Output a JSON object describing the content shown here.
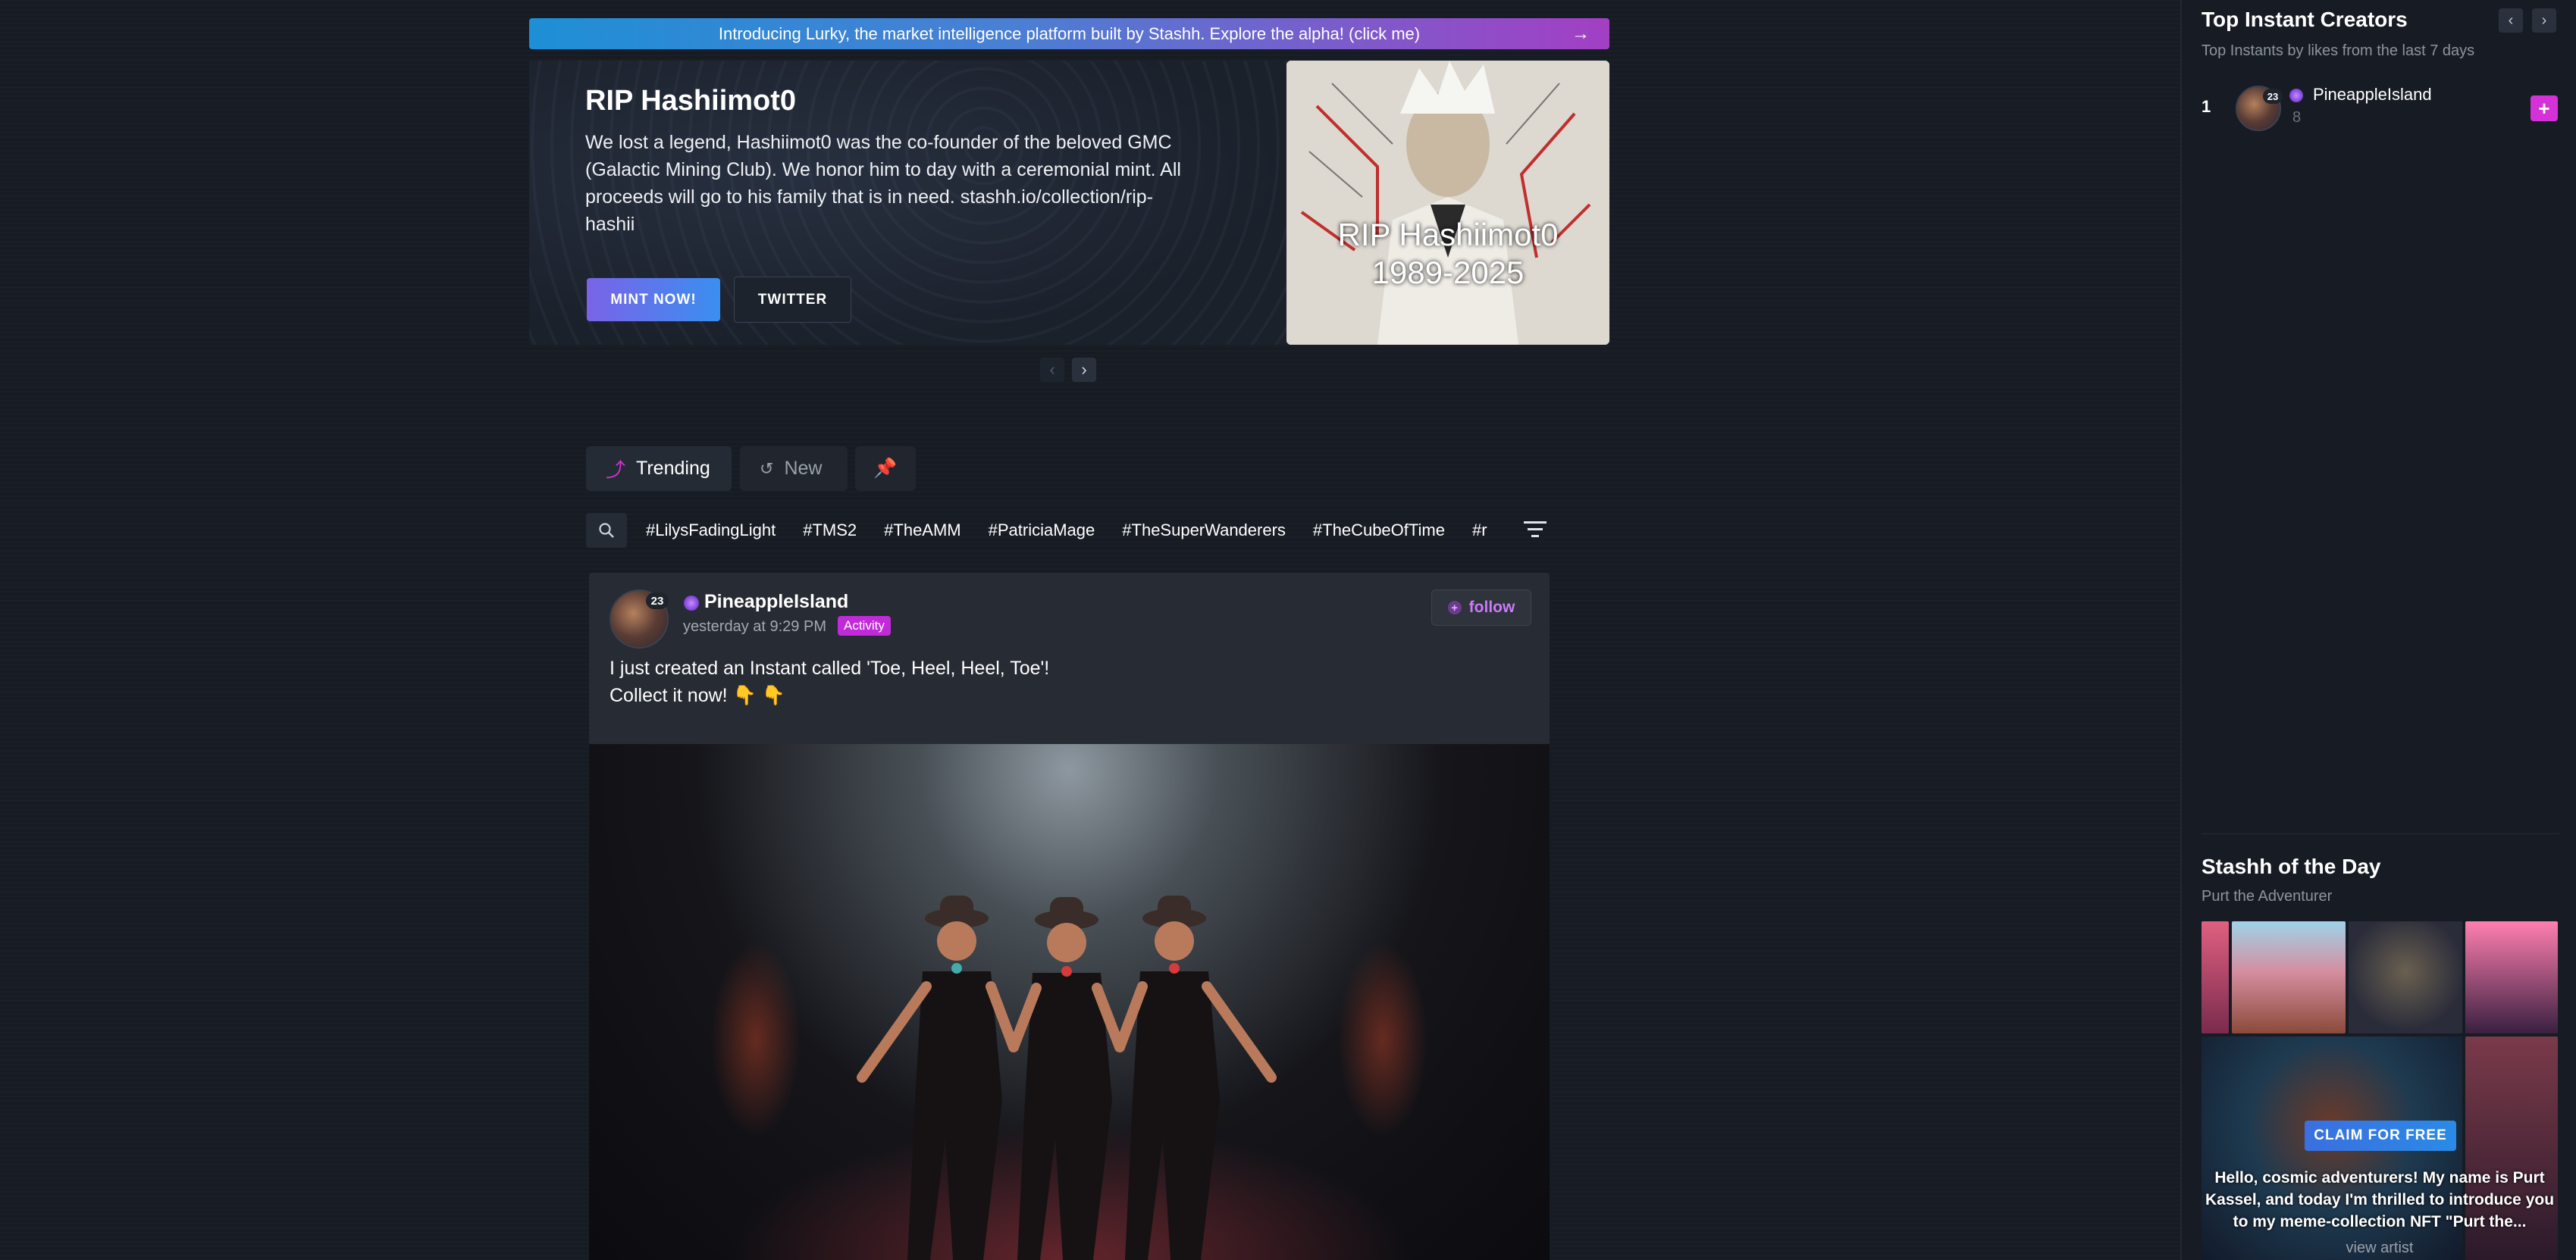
{
  "banner": {
    "text": "Introducing Lurky, the market intelligence platform built by Stashh. Explore the alpha! (click me)",
    "arrow": "→"
  },
  "hero": {
    "title": "RIP Hashiimot0",
    "description": "We lost a legend, Hashiimot0 was the co-founder of the beloved GMC (Galactic Mining Club). We honor him to day with a ceremonial mint. All proceeds will go to his family that is in need. stashh.io/collection/rip-hashii",
    "mint_label": "MINT NOW!",
    "twitter_label": "TWITTER",
    "image_caption_line1": "RIP Hashiimot0",
    "image_caption_line2": "1989-2025"
  },
  "tabs": [
    {
      "label": "Trending",
      "icon": "trending-arrow-icon"
    },
    {
      "label": "New",
      "icon": "history-icon"
    },
    {
      "label": "",
      "icon": "pin-icon"
    }
  ],
  "hashtags": [
    "#LilysFadingLight",
    "#TMS2",
    "#TheAMM",
    "#PatriciaMage",
    "#TheSuperWanderers",
    "#TheCubeOfTime",
    "#r"
  ],
  "post": {
    "level": "23",
    "user": "PineappleIsland",
    "time": "yesterday at 9:29 PM",
    "tag": "Activity",
    "follow_label": "follow",
    "text_line1": "I just created an Instant called 'Toe, Heel, Heel, Toe'!",
    "text_line2": "Collect it now! 👇 👇"
  },
  "sidebar": {
    "title": "Top Instant Creators",
    "subtitle": "Top Instants by likes from the last 7 days",
    "creators": [
      {
        "rank": "1",
        "level": "23",
        "user": "PineappleIsland",
        "likes": "8"
      }
    ],
    "add_label": "+",
    "sotd_title": "Stashh of the Day",
    "sotd_subtitle": "Purt the Adventurer",
    "claim_label": "CLAIM FOR FREE",
    "sotd_description": "Hello, cosmic adventurers! My name is Purt Kassel, and today I'm thrilled to introduce you to my meme-collection NFT \"Purt the...",
    "sotd_link": "view artist"
  },
  "colors": {
    "accent": "#d431d9",
    "banner_start": "#1e8fd6",
    "banner_end": "#a33fc4",
    "background": "#171c24"
  }
}
